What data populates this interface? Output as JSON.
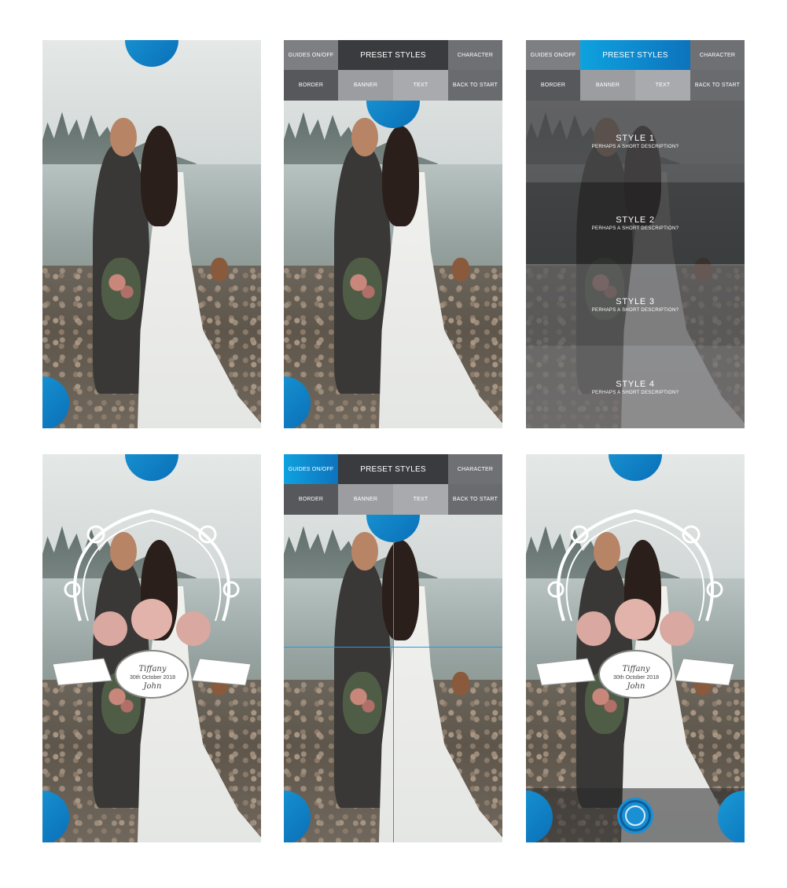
{
  "nav": {
    "guides": "GUIDES ON/OFF",
    "preset": "PRESET STYLES",
    "character": "CHARACTER",
    "border": "BORDER",
    "banner": "BANNER",
    "text": "TEXT",
    "back": "BACK TO START"
  },
  "styles": [
    {
      "title": "STYLE 1",
      "desc": "PERHAPS A SHORT DESCRIPTION?"
    },
    {
      "title": "STYLE 2",
      "desc": "PERHAPS A SHORT DESCRIPTION?"
    },
    {
      "title": "STYLE 3",
      "desc": "PERHAPS A SHORT DESCRIPTION?"
    },
    {
      "title": "STYLE 4",
      "desc": "PERHAPS A SHORT DESCRIPTION?"
    }
  ],
  "frame_text": {
    "name1": "Tiffany",
    "date": "30th October 2018",
    "name2": "John"
  },
  "colors": {
    "accent": "#0d8fd4",
    "nav_dark": "#3a3b3e",
    "nav_gray": "#7e7f82"
  },
  "icons": {
    "fab": "circle-button-icon",
    "shutter": "shutter-icon"
  }
}
